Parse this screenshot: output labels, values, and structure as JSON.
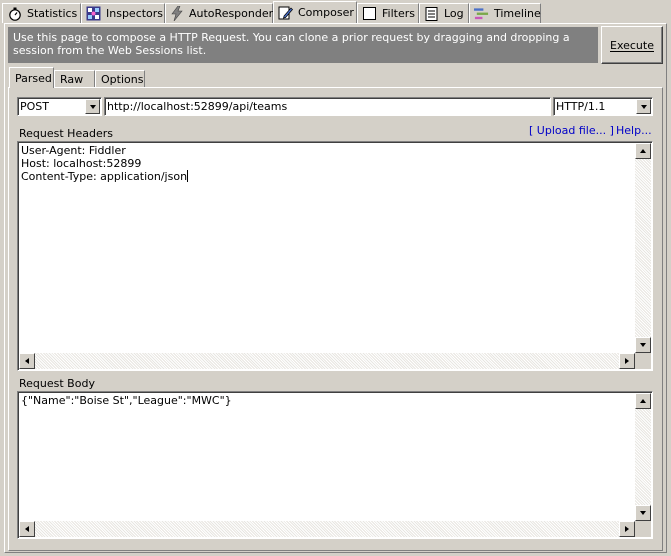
{
  "top_tabs": [
    {
      "label": "Statistics",
      "icon": "stopwatch-icon"
    },
    {
      "label": "Inspectors",
      "icon": "inspectors-icon"
    },
    {
      "label": "AutoResponder",
      "icon": "lightning-icon"
    },
    {
      "label": "Composer",
      "icon": "pencil-icon"
    },
    {
      "label": "Filters",
      "icon": "checkbox-icon"
    },
    {
      "label": "Log",
      "icon": "log-icon"
    },
    {
      "label": "Timeline",
      "icon": "timeline-icon"
    }
  ],
  "active_top_tab": "Composer",
  "banner": {
    "text": "Use this page to compose a HTTP Request. You can clone a prior request by dragging and dropping a session from the Web Sessions list."
  },
  "execute": {
    "label": "Execute"
  },
  "sub_tabs": [
    {
      "label": "Parsed"
    },
    {
      "label": "Raw"
    },
    {
      "label": "Options"
    }
  ],
  "active_sub_tab": "Parsed",
  "request_line": {
    "method": "POST",
    "url": "http://localhost:52899/api/teams",
    "version": "HTTP/1.1"
  },
  "headers_section": {
    "label": "Request Headers",
    "upload_link": "[ Upload file... ]",
    "help_link": "Help...",
    "lines": [
      "User-Agent: Fiddler",
      "Host: localhost:52899",
      "Content-Type: application/json"
    ]
  },
  "body_section": {
    "label": "Request Body",
    "text": "{\"Name\":\"Boise St\",\"League\":\"MWC\"}"
  },
  "colors": {
    "banner_bg": "#808080",
    "link": "#0000c8",
    "window_bg": "#d4d0c8"
  }
}
